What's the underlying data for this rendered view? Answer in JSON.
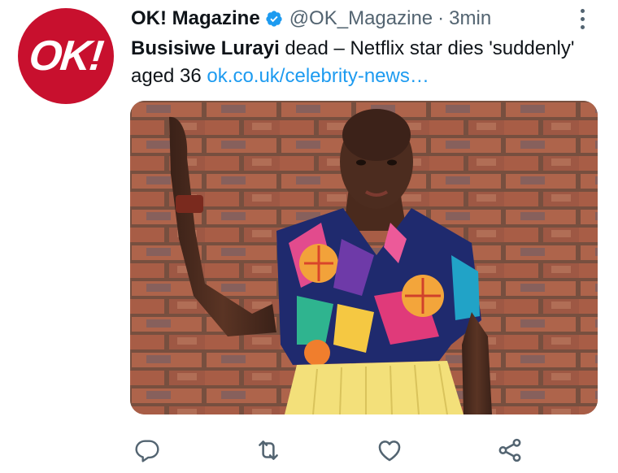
{
  "account": {
    "name": "OK! Magazine",
    "handle": "@OK_Magazine",
    "separator": "·",
    "time": "3min",
    "avatar_text": "OK!",
    "verified_color": "#1d9bf0",
    "brand_color": "#c8102e"
  },
  "tweet": {
    "bold_text": "Busisiwe Lurayi",
    "text": " dead – Netflix star dies 'suddenly' aged 36 ",
    "link": "ok.co.uk/celebrity-news…"
  },
  "media": {
    "icon": "photo-of-woman-against-brick-wall"
  },
  "actions": [
    {
      "name": "reply",
      "icon": "reply-icon"
    },
    {
      "name": "retweet",
      "icon": "retweet-icon"
    },
    {
      "name": "like",
      "icon": "heart-icon"
    },
    {
      "name": "share",
      "icon": "share-icon"
    }
  ],
  "colors": {
    "text": "#0f1419",
    "muted": "#536471",
    "link": "#1d9bf0"
  }
}
